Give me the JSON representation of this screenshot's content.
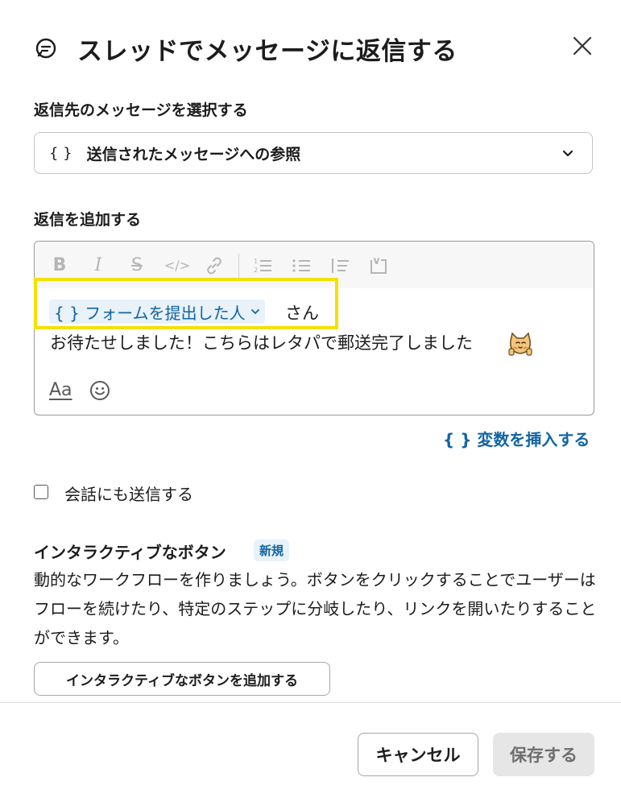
{
  "dialog": {
    "title": "スレッドでメッセージに返信する",
    "title_icon": "thread-reply-icon",
    "close_icon": "close-icon"
  },
  "reply_target": {
    "label": "返信先のメッセージを選択する",
    "brace": "{ }",
    "value": "送信されたメッセージへの参照",
    "icon": "chevron-down-icon"
  },
  "reply": {
    "label": "返信を追加する",
    "toolbar": {
      "bold": "B",
      "italic": "I",
      "strike": "S",
      "code": "</>",
      "icons": [
        "bold-icon",
        "italic-icon",
        "strikethrough-icon",
        "code-icon",
        "link-icon",
        "numbered-list-icon",
        "bulleted-list-icon",
        "quote-icon",
        "code-block-icon"
      ]
    },
    "variable_chip": "{ } フォームを提出した人",
    "after_chip": "さん",
    "message": "お待たせしました！こちらはレタパで郵送完了しました",
    "format_label": "Aa",
    "emoji_icon": "emoji-icon",
    "insert_variable": "{ } 変数を挿入する"
  },
  "conversation_checkbox": {
    "label": "会話にも送信する",
    "checked": false
  },
  "interactive_buttons": {
    "title": "インタラクティブなボタン",
    "badge": "新規",
    "description": "動的なワークフローを作りましょう。ボタンをクリックすることでユーザーはフローを続けたり、特定のステップに分岐したり、リンクを開いたりすることができます。",
    "add_button": "インタラクティブなボタンを追加する"
  },
  "footer": {
    "cancel": "キャンセル",
    "save": "保存する"
  },
  "colors": {
    "link": "#1264a3",
    "highlight": "#f5e000",
    "chip_bg": "#e8f2f8"
  }
}
